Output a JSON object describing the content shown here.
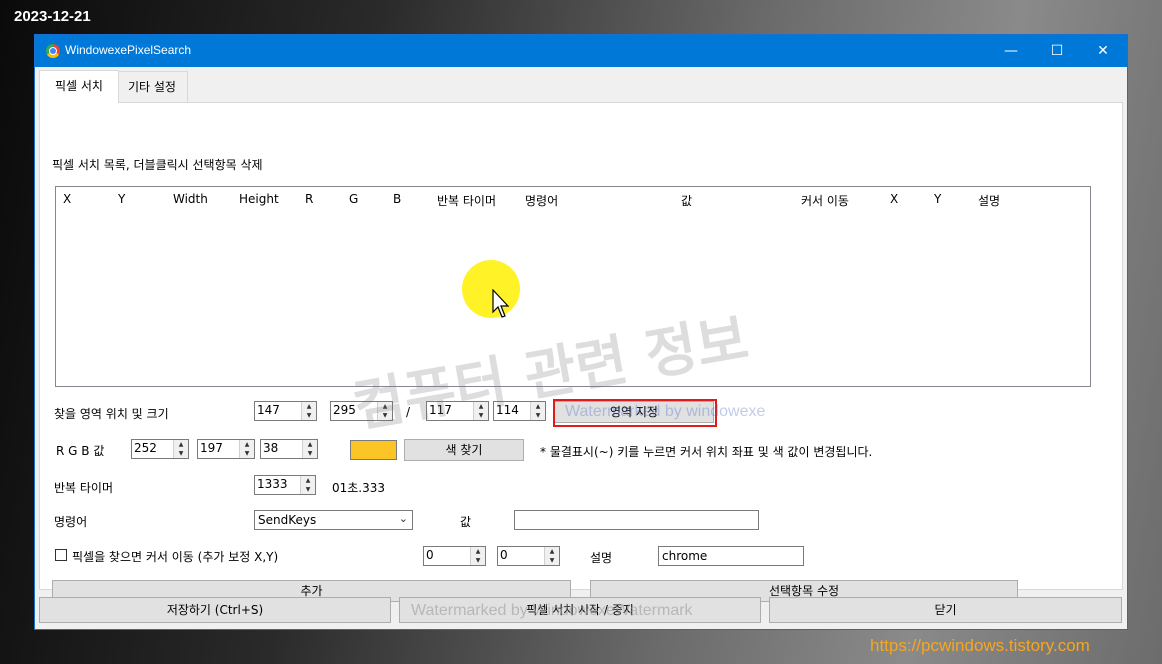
{
  "overlay": {
    "date": "2023-12-21",
    "site_url": "https://pcwindows.tistory.com",
    "watermark_main": "컴퓨터 관련 정보",
    "watermark_region": "Watermarked by windowexe",
    "watermark_bottom": "Watermarked by WindowexeWatermark"
  },
  "window": {
    "title": "WindowexePixelSearch",
    "app_icon": "chrome-icon",
    "controls": {
      "minimize": "—",
      "maximize": "☐",
      "close": "✕"
    }
  },
  "tabs": [
    {
      "label": "픽셀 서치",
      "active": true
    },
    {
      "label": "기타 설정",
      "active": false
    }
  ],
  "list": {
    "caption": "픽셀 서치 목록, 더블클릭시 선택항목 삭제",
    "columns": [
      "X",
      "Y",
      "Width",
      "Height",
      "R",
      "G",
      "B",
      "반복 타이머",
      "명령어",
      "값",
      "커서 이동",
      "X",
      "Y",
      "설명"
    ],
    "rows": []
  },
  "area": {
    "label": "찾을 영역 위치 및 크기",
    "x": "147",
    "y": "295",
    "separator": "/",
    "width": "117",
    "height": "114",
    "set_button": "영역 지정"
  },
  "rgb": {
    "label": "R G B 값",
    "r": "252",
    "g": "197",
    "b": "38",
    "swatch_color": "#fcc526",
    "find_button": "색 찾기",
    "hint": "* 물결표시(~) 키를 누르면 커서 위치 좌표 및 색 값이 변경됩니다."
  },
  "timer": {
    "label": "반복 타이머",
    "value": "1333",
    "readout": "01초.333"
  },
  "command": {
    "label": "명령어",
    "selected": "SendKeys",
    "value_label": "값",
    "value": ""
  },
  "cursor_move": {
    "checkbox_label": "픽셀을 찾으면 커서 이동 (추가 보정 X,Y)",
    "checked": false,
    "x": "0",
    "y": "0",
    "desc_label": "설명",
    "desc_value": "chrome"
  },
  "actions": {
    "add": "추가",
    "edit": "선택항목 수정",
    "save": "저장하기 (Ctrl+S)",
    "start_stop": "픽셀 서치 시작 / 중지",
    "close": "닫기"
  },
  "colors": {
    "titlebar": "#0078d7",
    "highlight_box": "#e01b1b",
    "site_url": "#f5a623",
    "cursor_spot": "#fff000"
  }
}
